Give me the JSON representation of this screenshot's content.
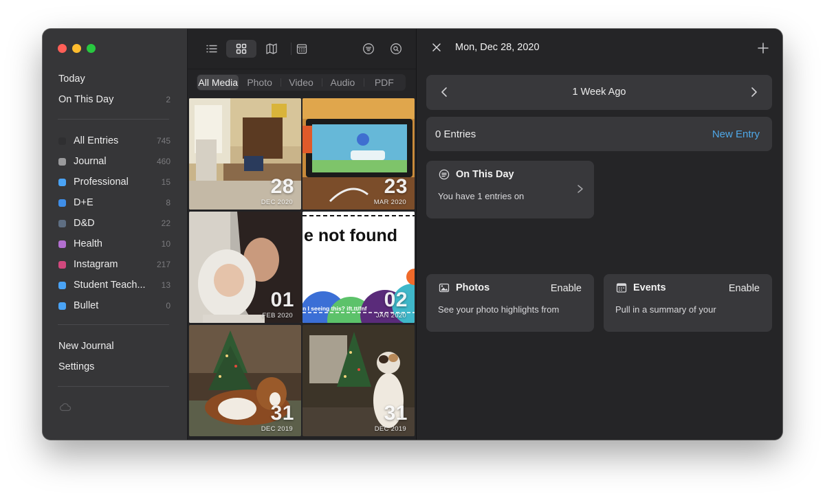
{
  "sidebar": {
    "top_items": [
      {
        "label": "Today",
        "count": ""
      },
      {
        "label": "On This Day",
        "count": "2"
      }
    ],
    "journals": [
      {
        "label": "All Entries",
        "count": "745",
        "color": "#2f2f31"
      },
      {
        "label": "Journal",
        "count": "460",
        "color": "#9a9a9c"
      },
      {
        "label": "Professional",
        "count": "15",
        "color": "#4aa3f5"
      },
      {
        "label": "D+E",
        "count": "8",
        "color": "#3f8ee8"
      },
      {
        "label": "D&D",
        "count": "22",
        "color": "#5e6e82"
      },
      {
        "label": "Health",
        "count": "10",
        "color": "#b26fd0"
      },
      {
        "label": "Instagram",
        "count": "217",
        "color": "#d1487d"
      },
      {
        "label": "Student Teach...",
        "count": "13",
        "color": "#4aa3f5"
      },
      {
        "label": "Bullet",
        "count": "0",
        "color": "#4aa3f5"
      }
    ],
    "bottom_items": [
      {
        "label": "New Journal"
      },
      {
        "label": "Settings"
      }
    ]
  },
  "media": {
    "toolbar_icons": [
      "list-icon",
      "grid-icon",
      "map-icon",
      "calendar-icon",
      "filter-icon",
      "search-icon"
    ],
    "segments": [
      "All Media",
      "Photo",
      "Video",
      "Audio",
      "PDF"
    ],
    "active_segment": "All Media",
    "tiles": [
      {
        "day": "28",
        "month": "DEC 2020",
        "scene": "room"
      },
      {
        "day": "23",
        "month": "MAR 2020",
        "scene": "tablet"
      },
      {
        "day": "01",
        "month": "FEB 2020",
        "scene": "baby"
      },
      {
        "day": "02",
        "month": "JAN 2020",
        "scene": "notfound",
        "text": "e not found",
        "small_text": "n I seeing this? ift.tt/fnf"
      },
      {
        "day": "31",
        "month": "DEC 2019",
        "scene": "dog"
      },
      {
        "day": "31",
        "month": "DEC 2019",
        "scene": "cat"
      }
    ]
  },
  "detail": {
    "title": "Mon, Dec 28, 2020",
    "week_label": "1 Week Ago",
    "entries_label": "0 Entries",
    "new_entry_label": "New Entry",
    "on_this_day": {
      "title": "On This Day",
      "body": "You have 1 entries on"
    },
    "photos": {
      "title": "Photos",
      "action": "Enable",
      "body": "See your photo highlights from"
    },
    "events": {
      "title": "Events",
      "action": "Enable",
      "body": "Pull in a summary of your"
    },
    "accent_color": "#4fa8e8"
  }
}
